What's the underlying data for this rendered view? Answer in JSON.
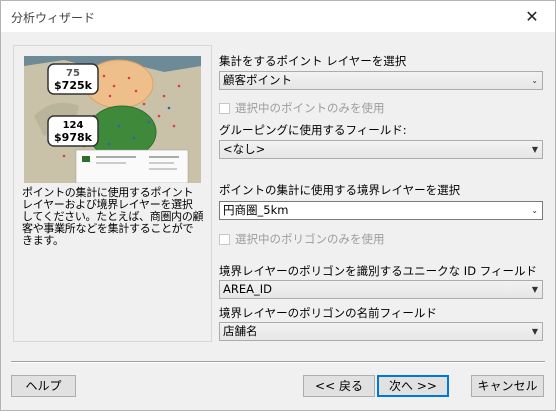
{
  "window": {
    "title": "分析ウィザード",
    "close_glyph": "✕"
  },
  "left": {
    "map": {
      "callout1": {
        "count": "75",
        "amount": "$725k"
      },
      "callout2": {
        "count": "124",
        "amount": "$978k"
      }
    },
    "description_lines": [
      "ポイントの集計に使用するポイント",
      "レイヤーおよび境界レイヤーを選択",
      "してください。たとえば、商圏内の顧",
      "客や事業所などを集計することがで",
      "きます。"
    ]
  },
  "form": {
    "point_layer_label": "集計をするポイント レイヤーを選択",
    "point_layer_value": "顧客ポイント",
    "selected_points_only": "選択中のポイントのみを使用",
    "grouping_label": "グルーピングに使用するフィールド:",
    "grouping_value": "<なし>",
    "boundary_layer_label": "ポイントの集計に使用する境界レイヤーを選択",
    "boundary_layer_value": "円商圏_5km",
    "selected_polygons_only": "選択中のポリゴンのみを使用",
    "id_field_label": "境界レイヤーのポリゴンを識別するユニークな ID フィールド",
    "id_field_value": "AREA_ID",
    "name_field_label": "境界レイヤーのポリゴンの名前フィールド",
    "name_field_value": "店舗名"
  },
  "buttons": {
    "help": "ヘルプ",
    "back": "<< 戻る",
    "next": "次へ >>",
    "cancel": "キャンセル"
  },
  "icons": {
    "dropdown_arrow": "▼",
    "dropdown_arrow_light": "⌄"
  }
}
